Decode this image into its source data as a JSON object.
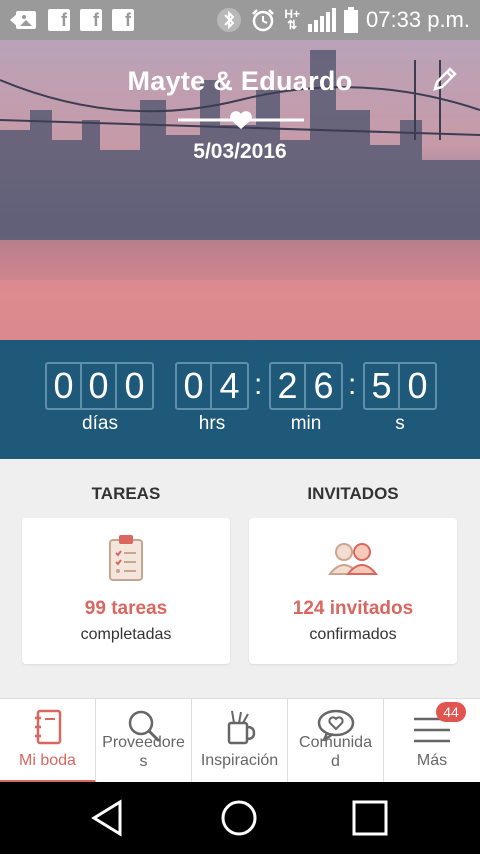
{
  "status_bar": {
    "time": "07:33 p.m.",
    "icons": [
      "image-icon",
      "facebook-icon",
      "facebook-icon",
      "facebook-icon",
      "bluetooth-icon",
      "alarm-icon",
      "hplus-icon",
      "signal-icon",
      "battery-icon"
    ],
    "fb_letter": "f",
    "network_label": "H+"
  },
  "hero": {
    "couple_names": "Mayte & Eduardo",
    "wedding_date": "5/03/2016"
  },
  "countdown": {
    "days": [
      "0",
      "0",
      "0"
    ],
    "hours": [
      "0",
      "4"
    ],
    "minutes": [
      "2",
      "6"
    ],
    "seconds": [
      "5",
      "0"
    ],
    "separator": ":",
    "labels": {
      "days": "días",
      "hours": "hrs",
      "minutes": "min",
      "seconds": "s"
    }
  },
  "summary": {
    "tasks": {
      "heading": "TAREAS",
      "count": "99 tareas",
      "sub": "completadas"
    },
    "guests": {
      "heading": "INVITADOS",
      "count": "124 invitados",
      "sub": "confirmados"
    }
  },
  "tabs": [
    {
      "label": "Mi boda",
      "icon": "notebook-icon",
      "active": true
    },
    {
      "label": "Proveedore\ns",
      "icon": "search-icon",
      "active": false
    },
    {
      "label": "Inspiración",
      "icon": "pencil-cup-icon",
      "active": false
    },
    {
      "label": "Comunida\nd",
      "icon": "heart-chat-icon",
      "active": false
    },
    {
      "label": "Más",
      "icon": "menu-icon",
      "active": false,
      "badge": "44"
    }
  ],
  "colors": {
    "accent": "#d9665f",
    "countdown_bg": "#1f5979",
    "status_bar": "#9a9a9a"
  }
}
